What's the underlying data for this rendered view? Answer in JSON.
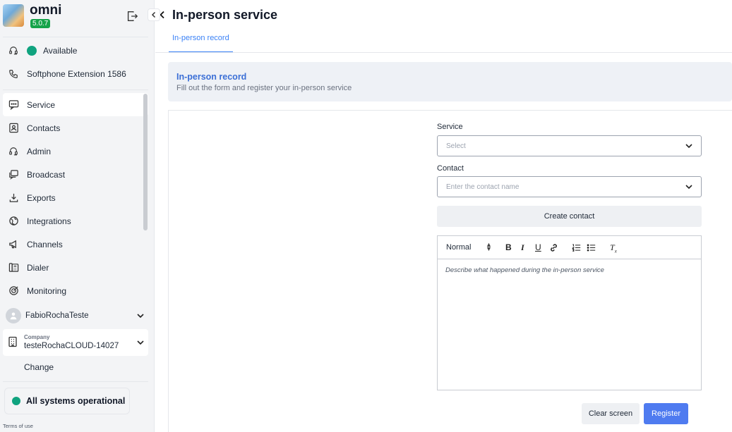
{
  "app": {
    "name": "omni",
    "version": "5.0.7"
  },
  "sidebar": {
    "status_label": "Available",
    "softphone_label": "Softphone Extension 1586",
    "nav": [
      {
        "label": "Service",
        "icon": "chat-icon",
        "active": true
      },
      {
        "label": "Contacts",
        "icon": "contact-card-icon"
      },
      {
        "label": "Admin",
        "icon": "headset-icon"
      },
      {
        "label": "Broadcast",
        "icon": "broadcast-icon"
      },
      {
        "label": "Exports",
        "icon": "download-icon"
      },
      {
        "label": "Integrations",
        "icon": "globe-icon"
      },
      {
        "label": "Channels",
        "icon": "megaphone-icon"
      },
      {
        "label": "Dialer",
        "icon": "dialer-icon"
      },
      {
        "label": "Monitoring",
        "icon": "target-icon"
      }
    ],
    "user": {
      "name": "FabioRochaTeste"
    },
    "company": {
      "label": "Company",
      "name": "testeRochaCLOUD-14027",
      "change_label": "Change"
    },
    "system_status": "All systems operational",
    "terms": "Terms of use"
  },
  "main": {
    "title": "In-person service",
    "tabs": [
      {
        "label": "In-person record",
        "active": true
      }
    ],
    "header": {
      "title": "In-person record",
      "subtitle": "Fill out the form and register your in-person service"
    },
    "form": {
      "service": {
        "label": "Service",
        "placeholder": "Select"
      },
      "contact": {
        "label": "Contact",
        "placeholder": "Enter the contact name"
      },
      "create_contact_label": "Create contact",
      "editor": {
        "format": "Normal",
        "placeholder": "Describe what happened during the in-person service"
      },
      "clear_label": "Clear screen",
      "register_label": "Register"
    }
  },
  "colors": {
    "accent": "#4f7bf0",
    "status_green": "#10a37f",
    "version_badge": "#16a34a"
  }
}
